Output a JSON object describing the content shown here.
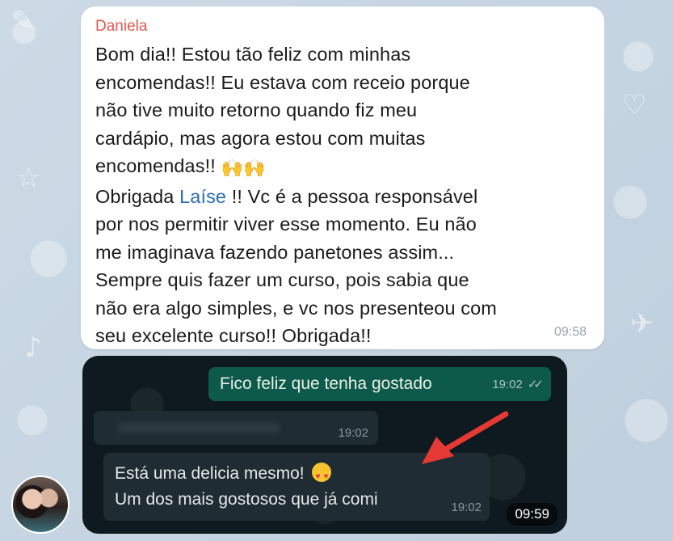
{
  "message_top": {
    "sender": "Daniela",
    "line_1": "Bom dia!! Estou tão feliz com minhas",
    "line_2": "encomendas!! Eu estava com receio porque",
    "line_3": "não tive muito retorno quando fiz meu",
    "line_4": "cardápio, mas agora estou com muitas",
    "line_5": "encomendas!!",
    "emoji": "🙌🙌",
    "line_6_before": "Obrigada ",
    "mention": "Laíse",
    "line_6_after": " !! Vc é a pessoa responsável",
    "line_7": "por nos permitir viver esse momento. Eu não",
    "line_8": "me imaginava fazendo panetones assim...",
    "line_9": "Sempre quis fazer um curso, pois sabia que",
    "line_10": "não era algo simples, e vc nos presenteou com",
    "line_11": "seu excelente curso!! Obrigada!!",
    "time": "09:58"
  },
  "screenshot": {
    "outgoing_text": "Fico feliz que tenha gostado",
    "outgoing_time": "19:02",
    "redacted_time": "19:02",
    "incoming_line_1": "Está uma delicia mesmo!",
    "incoming_line_2": "Um dos mais gostosos que já comi",
    "incoming_time": "19:02",
    "bubble_time": "09:59"
  },
  "colors": {
    "sender": "#e2584f",
    "mention": "#2a6cb5",
    "arrow": "#e53935",
    "outgoing_bubble": "#0d5a4b",
    "incoming_bubble": "#1f2c33"
  }
}
